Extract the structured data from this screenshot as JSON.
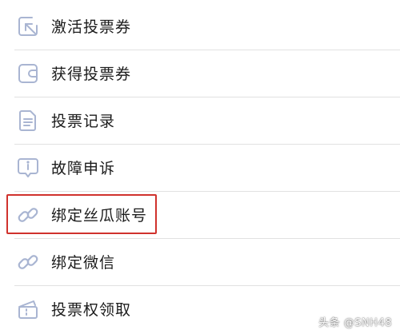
{
  "menu": {
    "items": [
      {
        "label": "激活投票券",
        "icon": "activate-arrow-icon"
      },
      {
        "label": "获得投票券",
        "icon": "wallet-icon"
      },
      {
        "label": "投票记录",
        "icon": "document-icon"
      },
      {
        "label": "故障申诉",
        "icon": "info-bubble-icon"
      },
      {
        "label": "绑定丝瓜账号",
        "icon": "link-icon"
      },
      {
        "label": "绑定微信",
        "icon": "link-icon"
      },
      {
        "label": "投票权领取",
        "icon": "ticket-icon"
      }
    ]
  },
  "highlight": {
    "item": "绑定丝瓜账号",
    "color": "#d0322d"
  },
  "watermark": {
    "text": "头条 @SNH48"
  },
  "colors": {
    "icon_stroke": "#a9b5d2",
    "text": "#1b1b1b",
    "divider": "#e1e1e1"
  }
}
